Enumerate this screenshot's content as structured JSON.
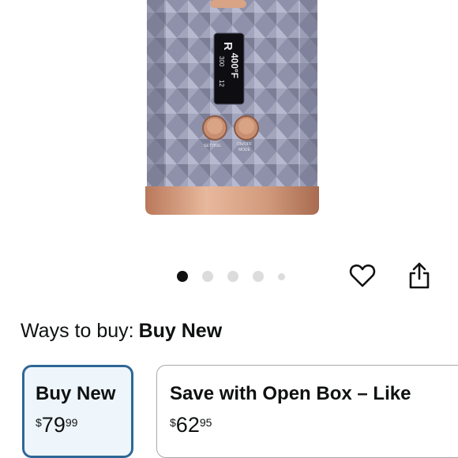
{
  "product_image": {
    "display_top_line": "400°F",
    "display_badge": "R",
    "display_small_1": "12",
    "display_small_2": "300",
    "button_left_label": "SETTING",
    "button_right_label_1": "ON/OFF",
    "button_right_label_2": "MODE"
  },
  "carousel": {
    "dot_count": 5,
    "active_index": 0
  },
  "actions": {
    "wishlist_icon": "heart-icon",
    "share_icon": "share-icon"
  },
  "ways_to_buy": {
    "label": "Ways to buy:",
    "value": "Buy New"
  },
  "options": [
    {
      "title": "Buy New",
      "currency": "$",
      "whole": "79",
      "fraction": "99",
      "selected": true
    },
    {
      "title": "Save with Open Box – Like",
      "currency": "$",
      "whole": "62",
      "fraction": "95",
      "selected": false
    }
  ],
  "colors": {
    "selected_border": "#2e6796",
    "selected_bg": "#eef5fb",
    "body": "#8e90a8",
    "accent": "#d7a184"
  }
}
